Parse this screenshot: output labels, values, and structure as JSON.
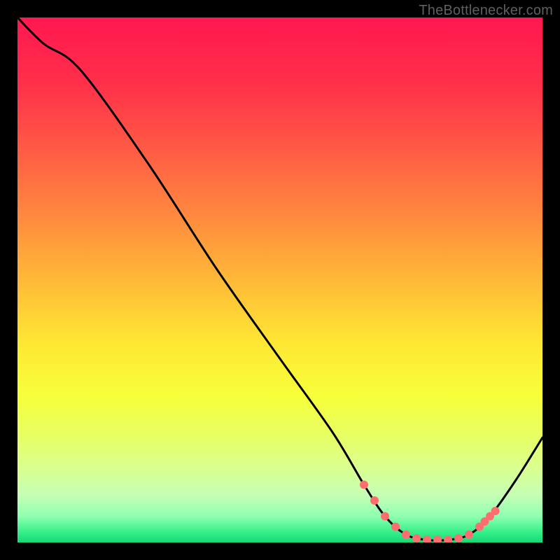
{
  "watermark": "TheBottlenecker.com",
  "chart_data": {
    "type": "line",
    "title": "",
    "xlabel": "",
    "ylabel": "",
    "xlim": [
      0,
      100
    ],
    "ylim": [
      0,
      100
    ],
    "note": "Axes, ticks and labels are not rendered in the original image; values are positional estimates (0–100 in each axis) read from the line path and marker placement.",
    "series": [
      {
        "name": "curve",
        "values": [
          {
            "x": 0,
            "y": 100
          },
          {
            "x": 5,
            "y": 95
          },
          {
            "x": 12,
            "y": 90
          },
          {
            "x": 25,
            "y": 72
          },
          {
            "x": 38,
            "y": 52
          },
          {
            "x": 50,
            "y": 35
          },
          {
            "x": 60,
            "y": 21
          },
          {
            "x": 66,
            "y": 11
          },
          {
            "x": 70,
            "y": 5
          },
          {
            "x": 74,
            "y": 1.5
          },
          {
            "x": 78,
            "y": 0.5
          },
          {
            "x": 82,
            "y": 0.5
          },
          {
            "x": 86,
            "y": 1.5
          },
          {
            "x": 90,
            "y": 5
          },
          {
            "x": 95,
            "y": 12
          },
          {
            "x": 100,
            "y": 20
          }
        ]
      },
      {
        "name": "highlight-dots",
        "values": [
          {
            "x": 66,
            "y": 11
          },
          {
            "x": 68,
            "y": 8
          },
          {
            "x": 70,
            "y": 5
          },
          {
            "x": 72,
            "y": 3
          },
          {
            "x": 74,
            "y": 1.5
          },
          {
            "x": 76,
            "y": 0.8
          },
          {
            "x": 78,
            "y": 0.5
          },
          {
            "x": 80,
            "y": 0.5
          },
          {
            "x": 82,
            "y": 0.5
          },
          {
            "x": 84,
            "y": 0.8
          },
          {
            "x": 86,
            "y": 1.5
          },
          {
            "x": 88,
            "y": 3
          },
          {
            "x": 89,
            "y": 4
          },
          {
            "x": 90,
            "y": 5
          },
          {
            "x": 91,
            "y": 6
          }
        ]
      }
    ],
    "gradient_colors": [
      "#ff1850",
      "#ff2e4a",
      "#ff5a45",
      "#ff8a3e",
      "#ffb938",
      "#ffe733",
      "#f7ff3a",
      "#e7ff66",
      "#d9ff90",
      "#c5ffb5",
      "#8fffb0",
      "#36f08a",
      "#17d877"
    ],
    "dot_color": "#ff6e6e",
    "curve_color": "#000000"
  }
}
